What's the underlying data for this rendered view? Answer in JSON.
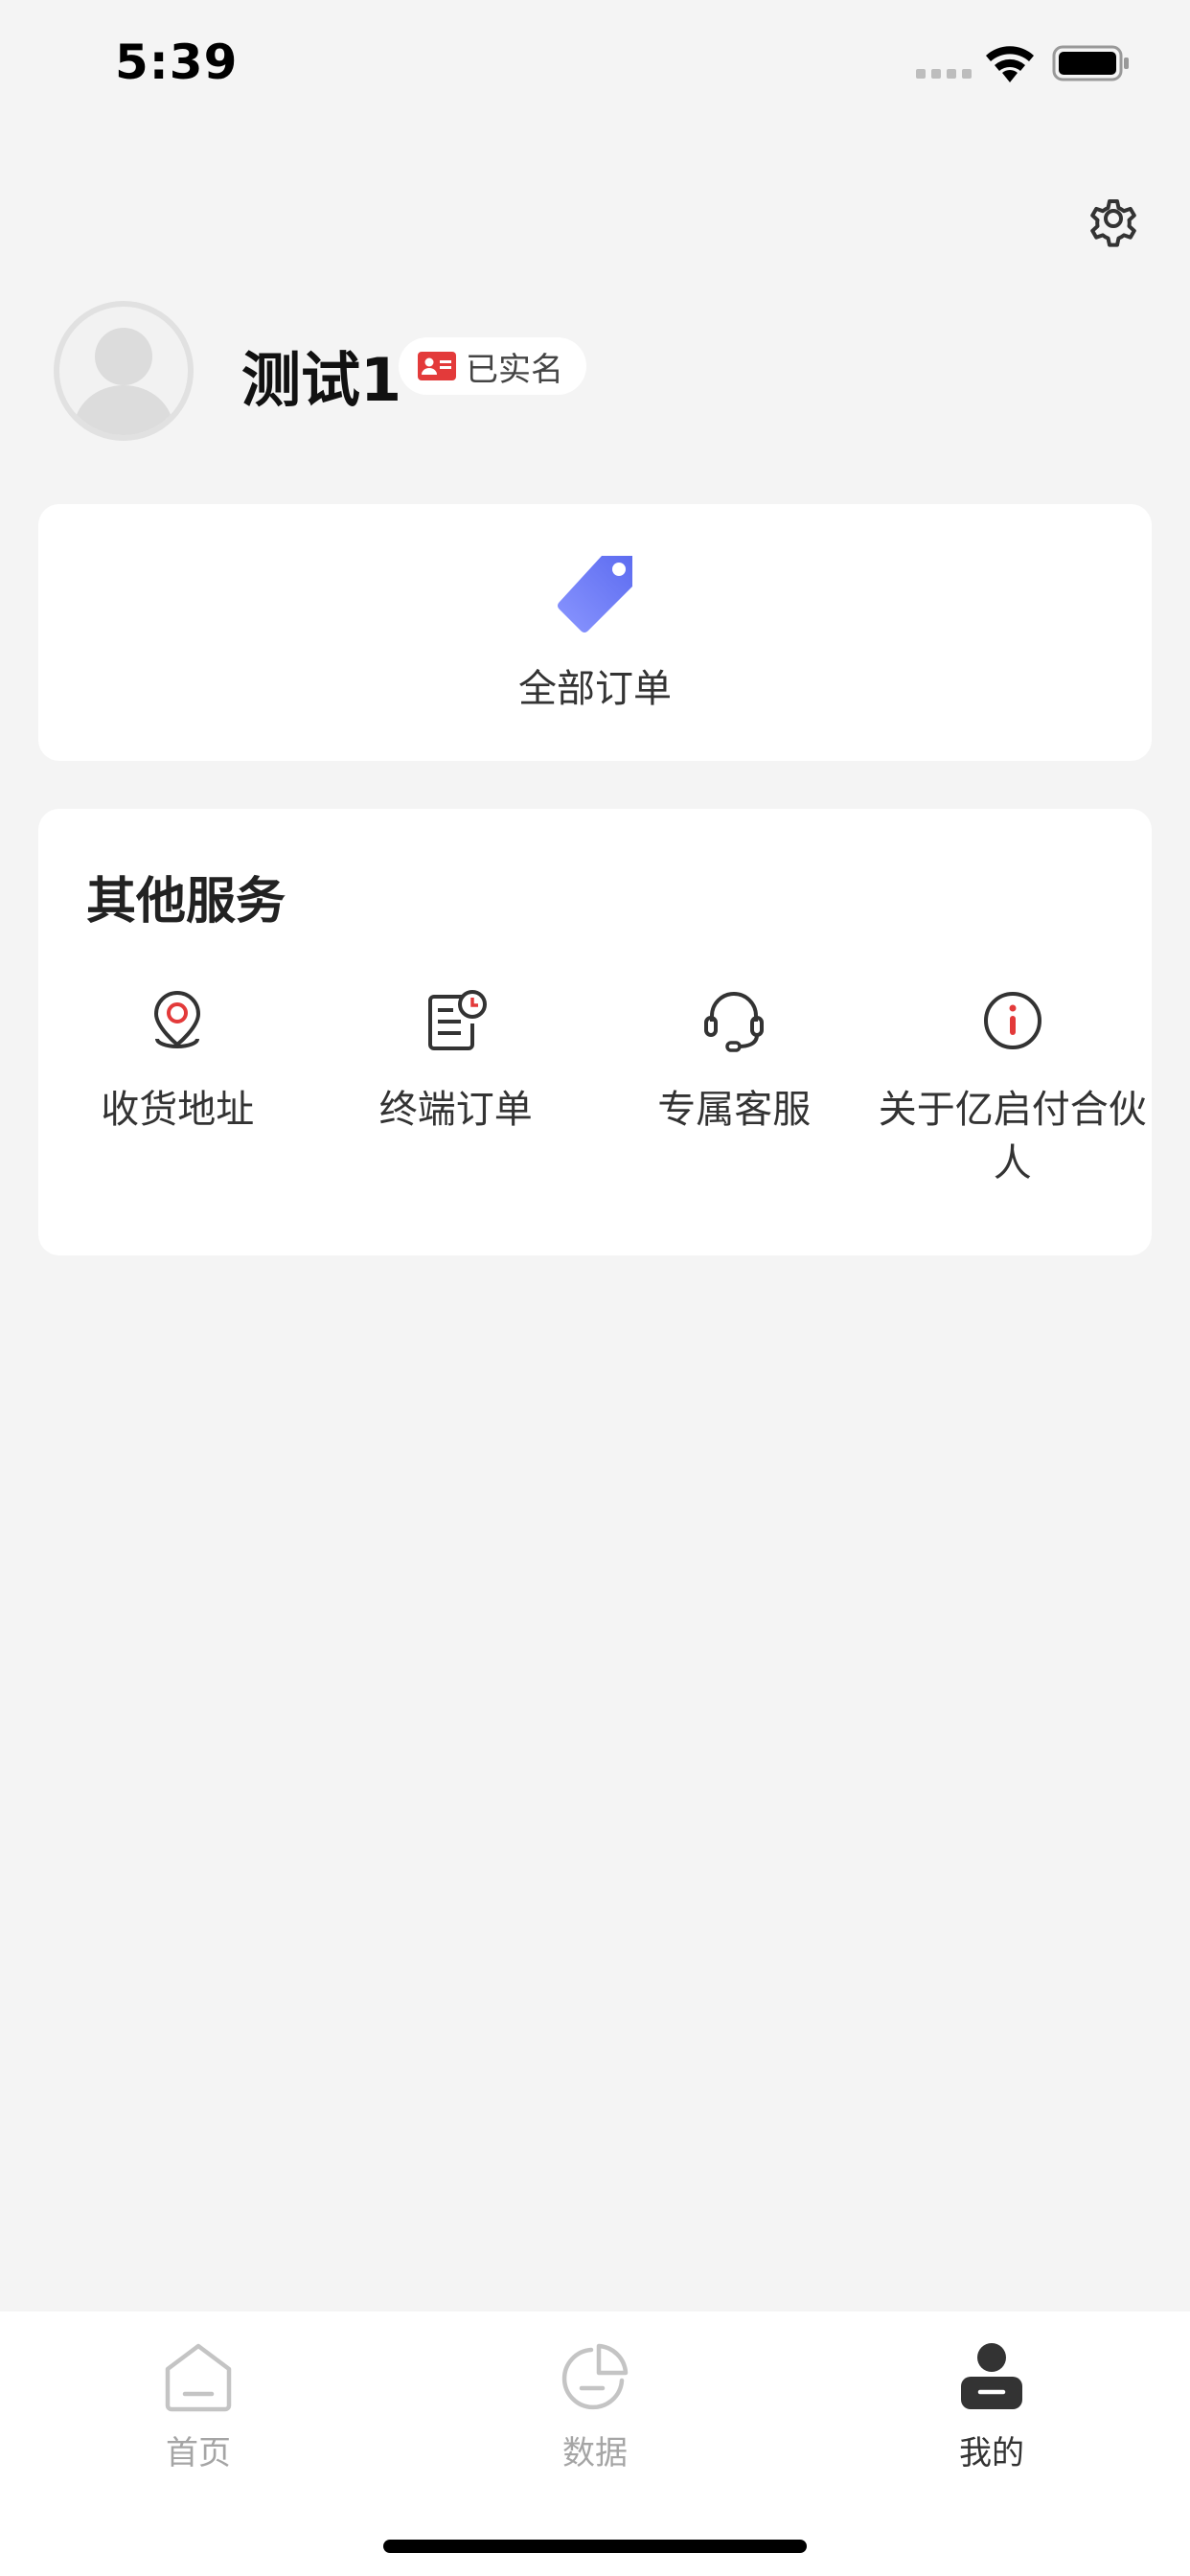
{
  "status_bar": {
    "time": "5:39"
  },
  "profile": {
    "name": "测试1",
    "verified_label": "已实名"
  },
  "orders": {
    "all_orders_label": "全部订单"
  },
  "services": {
    "title": "其他服务",
    "items": [
      {
        "label": "收货地址",
        "icon": "location-pin-icon"
      },
      {
        "label": "终端订单",
        "icon": "order-clock-icon"
      },
      {
        "label": "专属客服",
        "icon": "headset-icon"
      },
      {
        "label": "关于亿启付合伙人",
        "icon": "info-icon"
      }
    ]
  },
  "tab_bar": {
    "items": [
      {
        "label": "首页",
        "icon": "home-icon",
        "active": false
      },
      {
        "label": "数据",
        "icon": "pie-chart-icon",
        "active": false
      },
      {
        "label": "我的",
        "icon": "user-icon",
        "active": true
      }
    ]
  },
  "colors": {
    "background": "#f4f4f4",
    "card": "#ffffff",
    "accent_red": "#e33a3a",
    "tag_blue": "#6d7bf5",
    "tab_inactive": "#a5a5a5",
    "tab_active": "#333333"
  }
}
